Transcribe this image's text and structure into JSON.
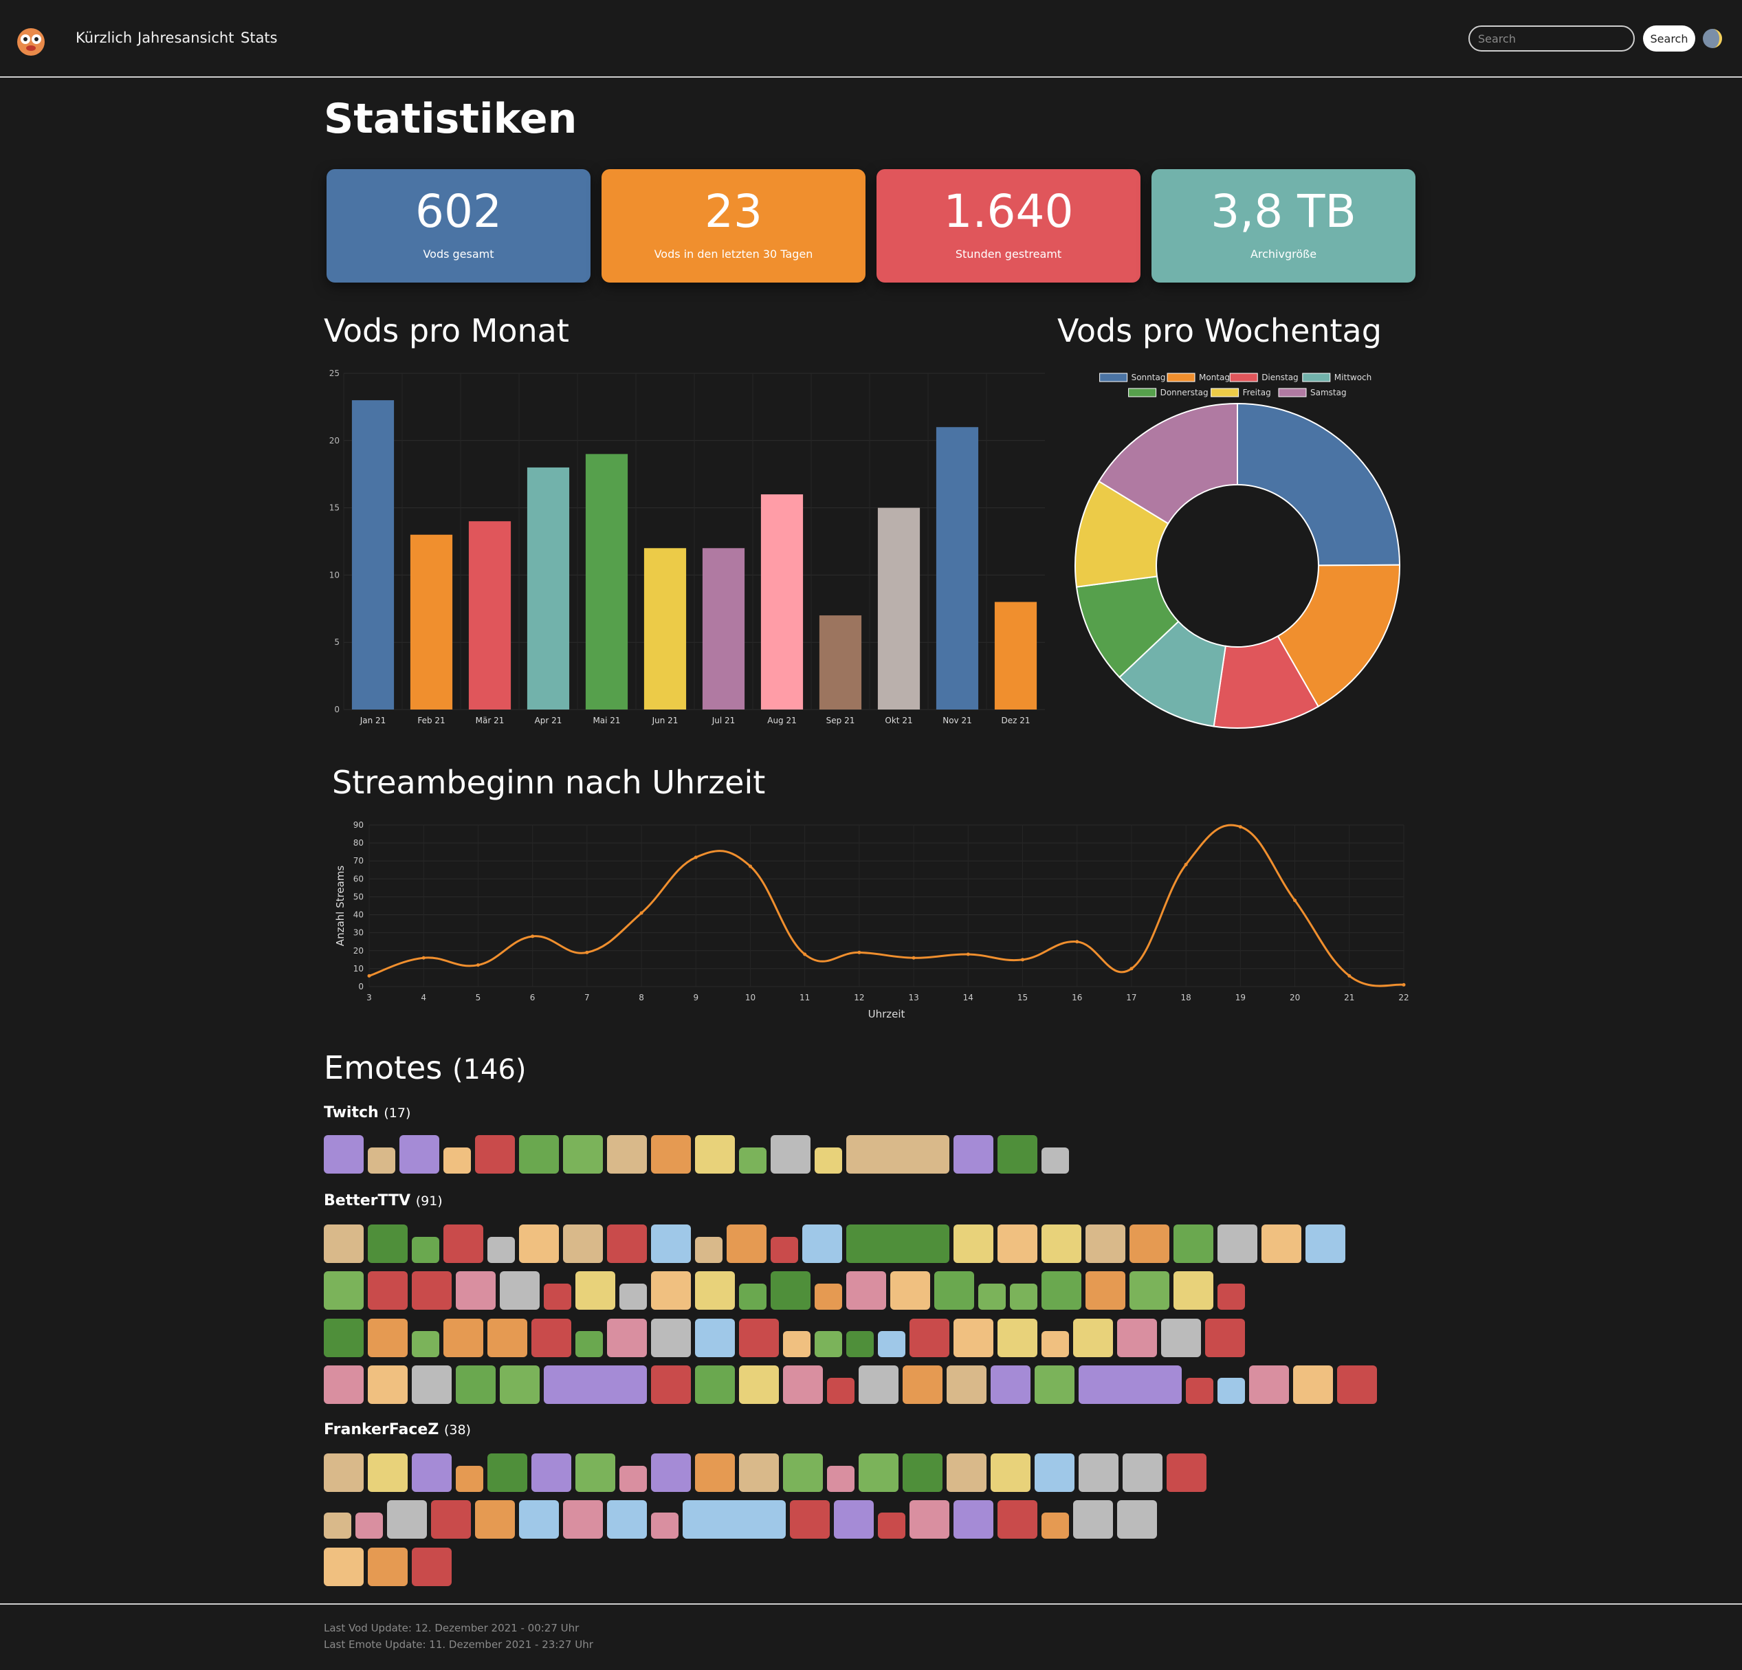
{
  "nav": {
    "links": [
      "Kürzlich",
      "Jahresansicht",
      "Stats"
    ],
    "search_placeholder": "Search",
    "search_button": "Search"
  },
  "page": {
    "title": "Statistiken"
  },
  "cards": [
    {
      "value": "602",
      "label": "Vods gesamt",
      "color": "#4b74a4"
    },
    {
      "value": "23",
      "label": "Vods in den letzten 30 Tagen",
      "color": "#f08f2e"
    },
    {
      "value": "1.640",
      "label": "Stunden gestreamt",
      "color": "#e0565b"
    },
    {
      "value": "3,8 TB",
      "label": "Archivgröße",
      "color": "#72b2ab"
    }
  ],
  "sections": {
    "monthly": "Vods pro Monat",
    "weekday": "Vods pro Wochentag",
    "hourly": "Streambeginn nach Uhrzeit"
  },
  "chart_data": [
    {
      "type": "bar",
      "categories": [
        "Jan 21",
        "Feb 21",
        "Mär 21",
        "Apr 21",
        "Mai 21",
        "Jun 21",
        "Jul 21",
        "Aug 21",
        "Sep 21",
        "Okt 21",
        "Nov 21",
        "Dez 21"
      ],
      "values": [
        23,
        13,
        14,
        18,
        19,
        12,
        12,
        16,
        7,
        15,
        21,
        8
      ],
      "colors": [
        "#4b74a4",
        "#f08f2e",
        "#e0565b",
        "#72b2ab",
        "#56a04c",
        "#eccb48",
        "#b07aa2",
        "#ff9da7",
        "#9c755f",
        "#bab0ac",
        "#4b74a4",
        "#f08f2e"
      ],
      "yticks": [
        0,
        5,
        10,
        15,
        20,
        25
      ],
      "ylim": [
        0,
        25
      ],
      "title": "",
      "xlabel": "",
      "ylabel": ""
    },
    {
      "type": "pie",
      "donut": true,
      "labels": [
        "Sonntag",
        "Montag",
        "Dienstag",
        "Mittwoch",
        "Donnerstag",
        "Freitag",
        "Samstag"
      ],
      "values": [
        150,
        101,
        64,
        64,
        60,
        65,
        98
      ],
      "colors": [
        "#4b74a4",
        "#f08f2e",
        "#e0565b",
        "#72b2ab",
        "#56a04c",
        "#eccb48",
        "#b07aa2"
      ],
      "legend": "top"
    },
    {
      "type": "line",
      "x": [
        3,
        4,
        5,
        6,
        7,
        8,
        9,
        10,
        11,
        12,
        13,
        14,
        15,
        16,
        17,
        18,
        19,
        20,
        21,
        22
      ],
      "values": [
        6,
        16,
        12,
        28,
        19,
        41,
        72,
        67,
        18,
        19,
        16,
        18,
        15,
        25,
        10,
        68,
        89,
        48,
        6,
        1
      ],
      "yticks": [
        0,
        10,
        20,
        30,
        40,
        50,
        60,
        70,
        80,
        90
      ],
      "ylim": [
        0,
        90
      ],
      "color": "#f08f2e",
      "xlabel": "Uhrzeit",
      "ylabel": "Anzahl Streams"
    }
  ],
  "emotes": {
    "title": "Emotes",
    "total": "(146)",
    "groups": [
      {
        "name": "Twitch",
        "count": "(17)"
      },
      {
        "name": "BetterTTV",
        "count": "(91)"
      },
      {
        "name": "FrankerFaceZ",
        "count": "(38)"
      }
    ]
  },
  "footer": {
    "vod_update": "Last Vod Update: 12. Dezember 2021 - 00:27 Uhr",
    "emote_update": "Last Emote Update: 11. Dezember 2021 - 23:27 Uhr"
  }
}
